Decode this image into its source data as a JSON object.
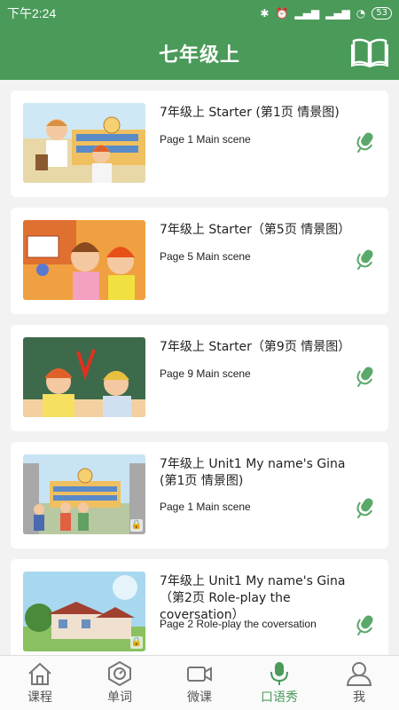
{
  "status": {
    "time": "下午2:24",
    "battery": "53"
  },
  "header": {
    "title": "七年级上",
    "book_icon": "book-icon"
  },
  "lessons": [
    {
      "title": "7年级上 Starter (第1页 情景图)",
      "subtitle": "Page 1 Main scene"
    },
    {
      "title": "7年级上 Starter（第5页 情景图）",
      "subtitle": "Page 5 Main scene"
    },
    {
      "title": "7年级上 Starter（第9页 情景图）",
      "subtitle": "Page 9 Main scene"
    },
    {
      "title": "7年级上 Unit1 My name's Gina (第1页 情景图)",
      "subtitle": "Page 1 Main scene"
    },
    {
      "title": "7年级上 Unit1 My name's Gina（第2页 Role-play the coversation）",
      "subtitle": "Page 2 Role-play the coversation"
    }
  ],
  "tabs": [
    {
      "label": "课程",
      "icon": "home-icon"
    },
    {
      "label": "单词",
      "icon": "word-icon"
    },
    {
      "label": "微课",
      "icon": "video-icon"
    },
    {
      "label": "口语秀",
      "icon": "mic-icon"
    },
    {
      "label": "我",
      "icon": "user-icon"
    }
  ],
  "colors": {
    "brand": "#4a9a5a",
    "mic": "#5aa86a"
  }
}
